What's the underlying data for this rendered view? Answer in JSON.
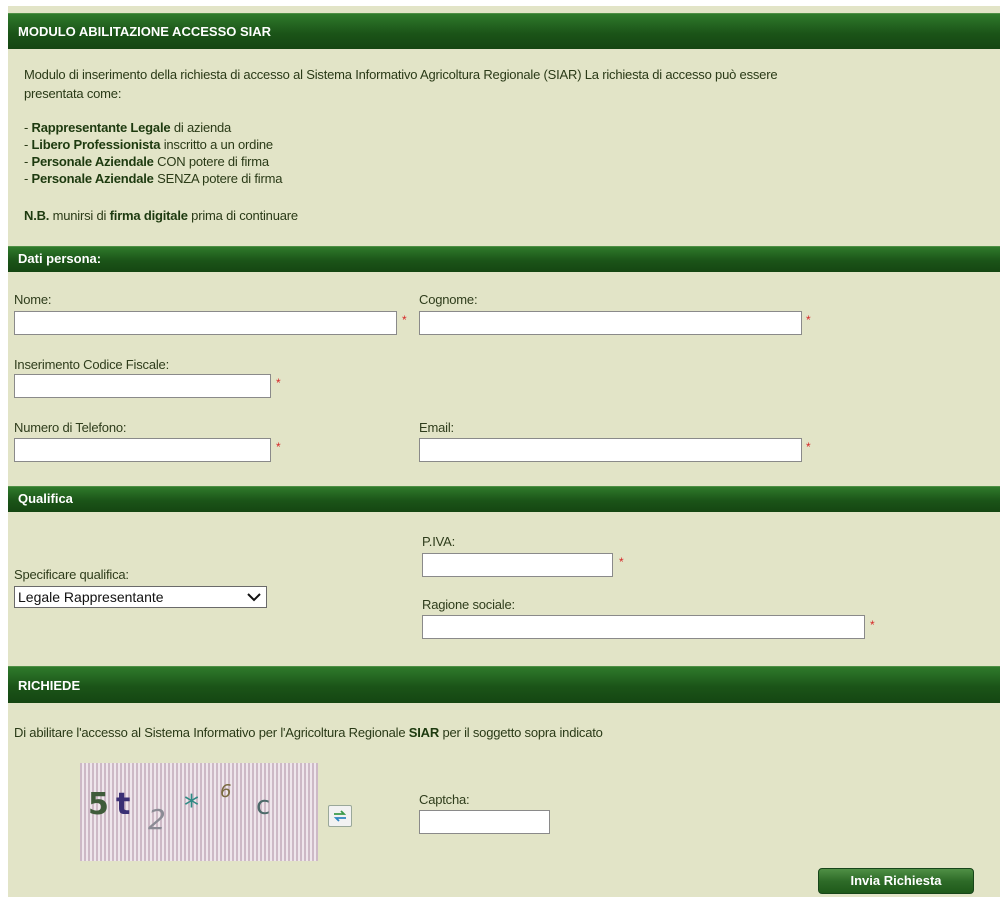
{
  "header": {
    "title": "MODULO ABILITAZIONE ACCESSO SIAR"
  },
  "intro": {
    "line1": "Modulo di inserimento della richiesta di accesso al Sistema Informativo Agricoltura Regionale (SIAR) La richiesta di accesso può essere",
    "line2": "presentata come:",
    "options": [
      {
        "prefix": "- ",
        "bold": "Rappresentante Legale",
        "rest": " di azienda"
      },
      {
        "prefix": "- ",
        "bold": "Libero Professionista",
        "rest": " inscritto a un ordine"
      },
      {
        "prefix": "- ",
        "bold": "Personale Aziendale",
        "rest": " CON potere di firma"
      },
      {
        "prefix": "- ",
        "bold": "Personale Aziendale",
        "rest": " SENZA potere di firma"
      }
    ],
    "note": {
      "bold1": "N.B.",
      "text1": " munirsi di ",
      "bold2": "firma digitale",
      "text2": " prima di continuare"
    }
  },
  "sections": {
    "dati_persona": "Dati persona:",
    "qualifica": "Qualifica",
    "richiede": "RICHIEDE"
  },
  "fields": {
    "nome": {
      "label": "Nome:",
      "value": ""
    },
    "cognome": {
      "label": "Cognome:",
      "value": ""
    },
    "codice_fiscale": {
      "label": "Inserimento Codice Fiscale:",
      "value": ""
    },
    "telefono": {
      "label": "Numero di Telefono:",
      "value": ""
    },
    "email": {
      "label": "Email:",
      "value": ""
    },
    "piva": {
      "label": "P.IVA:",
      "value": ""
    },
    "ragione_sociale": {
      "label": "Ragione sociale:",
      "value": ""
    },
    "captcha": {
      "label": "Captcha:",
      "value": ""
    }
  },
  "required_mark": "*",
  "qualifica": {
    "label": "Specificare qualifica:",
    "selected": "Legale Rappresentante"
  },
  "richiede": {
    "text_before": "Di abilitare l'accesso al Sistema Informativo per l'Agricoltura Regionale ",
    "bold": "SIAR",
    "text_after": " per il soggetto sopra indicato"
  },
  "captcha_image": {
    "chars": [
      "5",
      "t",
      "2",
      "*",
      "6",
      "c"
    ]
  },
  "submit": {
    "label": "Invia Richiesta"
  },
  "colors": {
    "panel_bg": "#e2e4c7",
    "header_green": "#1b5418",
    "required_red": "#d62828"
  },
  "icons": {
    "refresh": "refresh-captcha-icon",
    "select": "chevron-down-icon"
  }
}
